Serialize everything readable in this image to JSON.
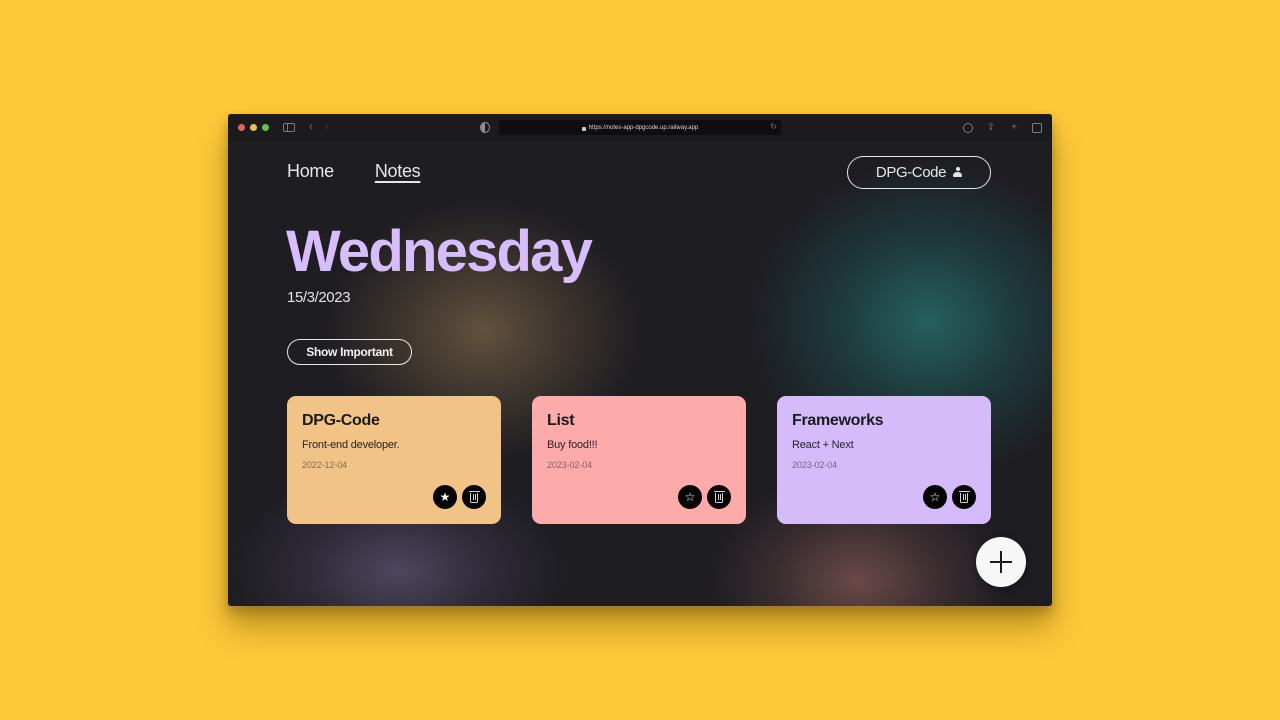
{
  "browser": {
    "url": "https://notes-app-dpgcode.up.railway.app",
    "icons": {
      "close": "traffic-close",
      "minimize": "traffic-minimize",
      "zoom": "traffic-zoom",
      "sidebar": "sidebar-icon",
      "back": "‹",
      "forward": "›",
      "reload": "↻",
      "download": "↓",
      "share": "share-icon",
      "new_tab": "+",
      "tabs": "tabs-icon"
    }
  },
  "nav": {
    "items": [
      {
        "label": "Home",
        "active": false
      },
      {
        "label": "Notes",
        "active": true
      }
    ]
  },
  "user": {
    "name": "DPG-Code"
  },
  "header": {
    "day": "Wednesday",
    "date": "15/3/2023"
  },
  "filters": {
    "show_important_label": "Show Important"
  },
  "notes": [
    {
      "title": "DPG-Code",
      "body": "Front-end developer.",
      "date": "2022-12-04",
      "important": true,
      "color": "#f2c387",
      "star": "★"
    },
    {
      "title": "List",
      "body": "Buy food!!!",
      "date": "2023-02-04",
      "important": false,
      "color": "#fdaaab",
      "star": "☆"
    },
    {
      "title": "Frameworks",
      "body": "React + Next",
      "date": "2023-02-04",
      "important": false,
      "color": "#d6bbfb",
      "star": "☆"
    }
  ],
  "colors": {
    "page_background": "#fdc93a",
    "app_background": "#1e1d22",
    "accent": "#d7bdfc"
  }
}
